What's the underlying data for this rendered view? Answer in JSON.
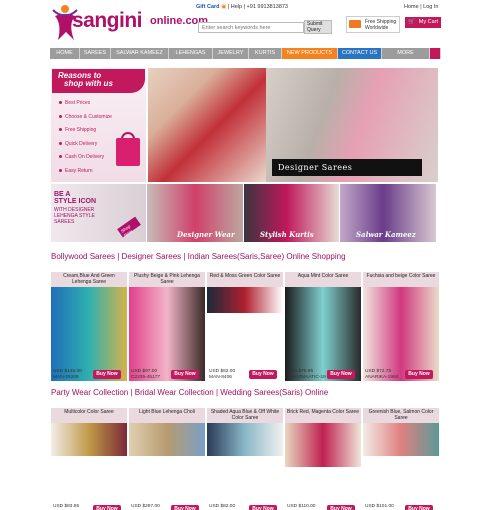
{
  "header": {
    "logo_main": "sangini",
    "logo_sub": "online.com",
    "gift_card": "Gift Card",
    "help_phone": "| Help | +91 9913813873",
    "home": "Home",
    "login": "Log In",
    "search_placeholder": "Enter search keywords here",
    "submit": "Submit Query",
    "free_shipping": "Free Shipping Worldwide",
    "my_cart": "My Cart"
  },
  "nav": [
    "HOME",
    "SAREES",
    "SALWAR KAMEEZ",
    "LEHENGAS",
    "JEWELRY",
    "KURTIS",
    "NEW PRODUCTS",
    "CONTACT US",
    "MORE"
  ],
  "reasons": {
    "title_line1": "Reasons to",
    "title_line2": "shop with us",
    "items": [
      "Best Prices",
      "Choose & Customize",
      "Free Shipping",
      "Quick Delivery",
      "Cash On Delivery",
      "Easy Return"
    ]
  },
  "banner": {
    "designer_sarees": "Designer Sarees"
  },
  "style_icon": {
    "line1": "BE A",
    "line2": "STYLE ICON",
    "line3": "WITH DESIGNER",
    "line4": "LEHENGA STYLE",
    "line5": "SAREES",
    "shop_now": "Shop Now"
  },
  "tiles": [
    "Designer Wear",
    "Stylish Kurtis",
    "Salwar Kameez"
  ],
  "section1": {
    "heading": "Bollywood Sarees | Designer Sarees | Indian Sarees(Saris,Saree) Online Shopping",
    "products": [
      {
        "title": "Cream,Blue And Green Lehenga Saree",
        "price": "USD $148.00",
        "code": "MAN-25209",
        "buy": "Buy Now",
        "colors": [
          "#1f6fb8",
          "#2fb0b0",
          "#d6b24a"
        ]
      },
      {
        "title": "Plushy Beige & Pink Lehenga Saree",
        "price": "USD $97.00",
        "code": "C2335-45177",
        "buy": "Buy Now",
        "colors": [
          "#e0408a",
          "#f2b4c8",
          "#3a2a28"
        ]
      },
      {
        "title": "Red & Moss Green Color Saree",
        "price": "USD $82.00",
        "code": "MAN-8406",
        "buy": "Buy Now",
        "colors": [
          "#1a2a3a",
          "#b02030",
          "#fff"
        ]
      },
      {
        "title": "Aqua Mint Color Saree",
        "price": "USD $75.95",
        "code": "KARIZMAATIC-19",
        "buy": "Buy Now",
        "colors": [
          "#1b1b1b",
          "#7fd0cf",
          "#2a2a2a"
        ]
      },
      {
        "title": "Fuchsia and beige Color Saree",
        "price": "USD $72.75",
        "code": "ANARIKA-1984",
        "buy": "Buy Now",
        "colors": [
          "#f1e6e0",
          "#d23880",
          "#eadcc8"
        ]
      }
    ]
  },
  "section2": {
    "heading": "Party Wear Collection | Bridal Wear Collection | Wedding Sarees(Saris) Online",
    "products": [
      {
        "title": "Multicolor Color Saree",
        "price": "USD $83.95",
        "buy": "Buy Now",
        "colors": [
          "#f2ede8",
          "#c09a48",
          "#7a2a38"
        ]
      },
      {
        "title": "Light Blue Lehenga Choli",
        "price": "USD $297.00",
        "buy": "Buy Now",
        "colors": [
          "#e0d0b0",
          "#b89a70",
          "#7aa0c8"
        ]
      },
      {
        "title": "Shaded Aqua Blue & Off White Color Saree",
        "price": "USD $82.00",
        "buy": "Buy Now",
        "colors": [
          "#2a3a58",
          "#8ab8c8",
          "#f0f0f0"
        ]
      },
      {
        "title": "Brick Red, Magenta Color Saree",
        "price": "USD $110.00",
        "buy": "Buy Now",
        "colors": [
          "#e8d8c0",
          "#c02050",
          "#f0e6d8"
        ]
      },
      {
        "title": "Greenish Blue, Salmon Color Saree",
        "price": "USD $101.00",
        "buy": "Buy Now",
        "colors": [
          "#f2ece6",
          "#e08080",
          "#5a9a98"
        ]
      }
    ]
  }
}
